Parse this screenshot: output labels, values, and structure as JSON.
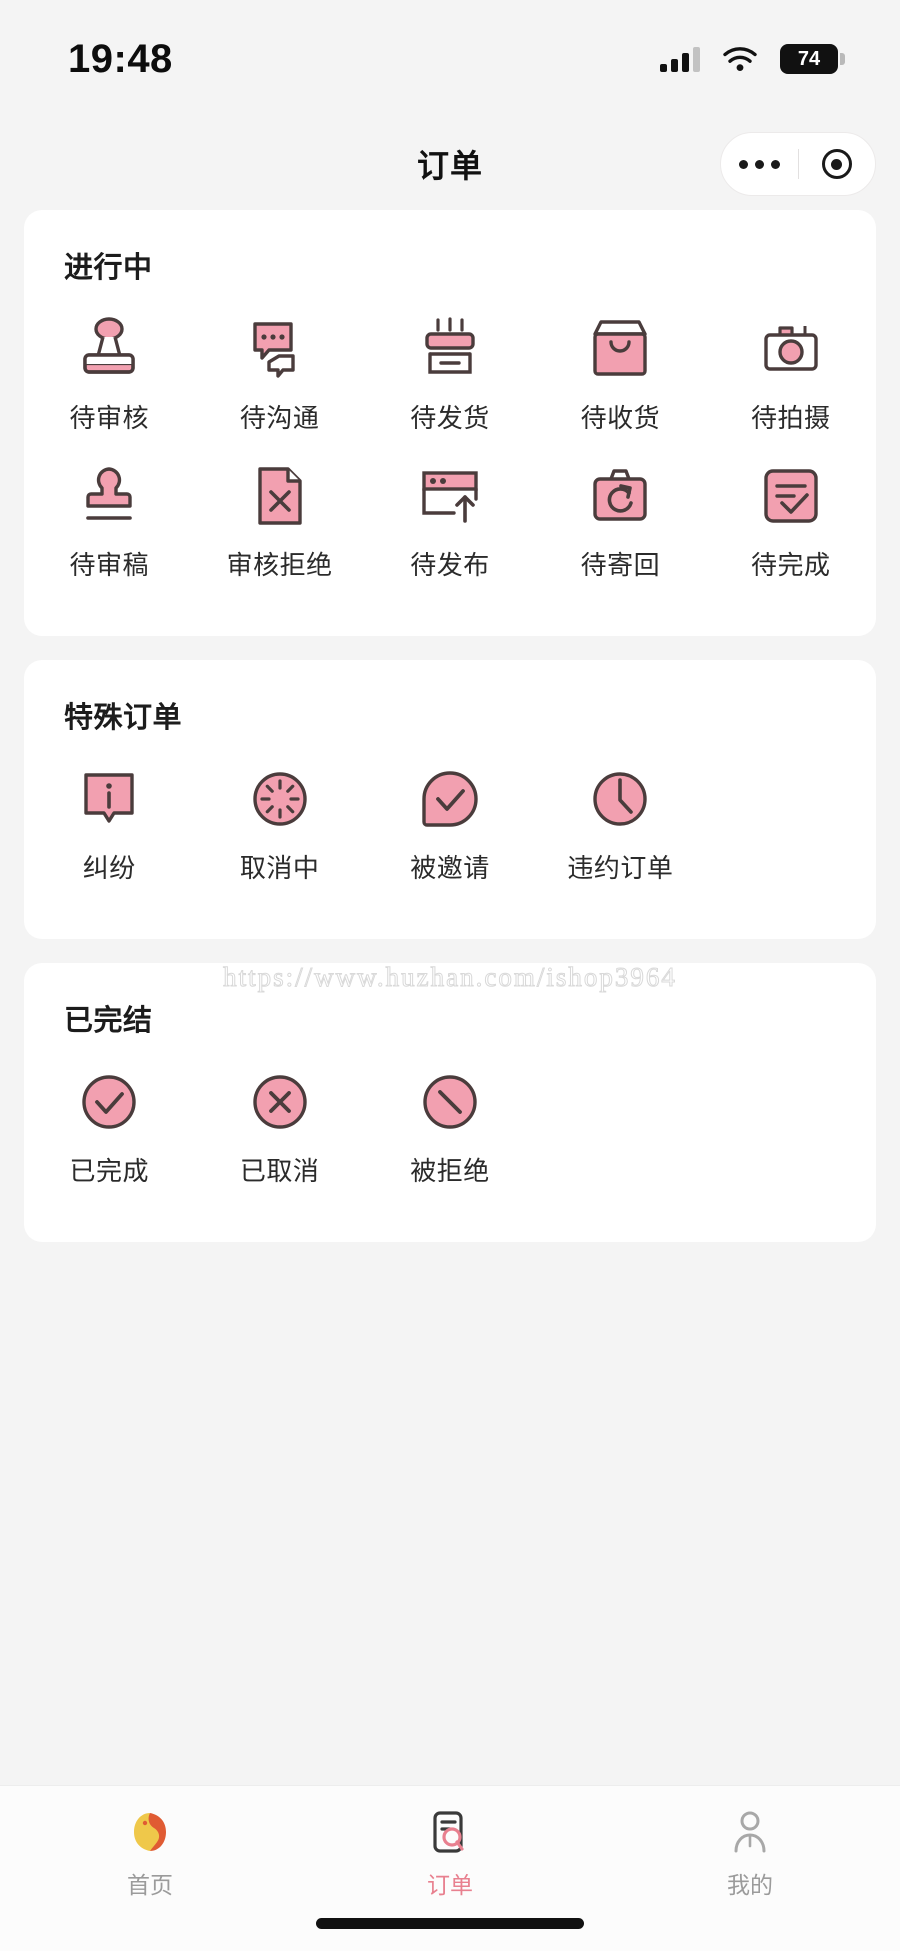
{
  "status_bar": {
    "time": "19:48",
    "battery_level": "74",
    "signal_icon": "cellular-signal-icon",
    "wifi_icon": "wifi-icon",
    "battery_icon": "battery-icon"
  },
  "header": {
    "title": "订单",
    "capsule": {
      "more_icon": "more-dots-icon",
      "target_icon": "target-circle-icon"
    }
  },
  "theme": {
    "accent": "#e8808f",
    "icon_fill": "#f2a0b0",
    "icon_stroke": "#4a3c3c",
    "page_bg": "#f4f4f4",
    "card_bg": "#ffffff"
  },
  "watermark": "https://www.huzhan.com/ishop3964",
  "sections": [
    {
      "title": "进行中",
      "items": [
        {
          "label": "待审核",
          "icon": "stamp-icon"
        },
        {
          "label": "待沟通",
          "icon": "chat-bubbles-icon"
        },
        {
          "label": "待发货",
          "icon": "package-ship-icon"
        },
        {
          "label": "待收货",
          "icon": "shopping-bag-icon"
        },
        {
          "label": "待拍摄",
          "icon": "camera-icon"
        },
        {
          "label": "待审稿",
          "icon": "stamp-press-icon"
        },
        {
          "label": "审核拒绝",
          "icon": "document-x-icon"
        },
        {
          "label": "待发布",
          "icon": "window-upload-icon"
        },
        {
          "label": "待寄回",
          "icon": "suitcase-return-icon"
        },
        {
          "label": "待完成",
          "icon": "checklist-icon"
        }
      ]
    },
    {
      "title": "特殊订单",
      "items": [
        {
          "label": "纠纷",
          "icon": "info-bubble-icon"
        },
        {
          "label": "取消中",
          "icon": "loading-spinner-icon"
        },
        {
          "label": "被邀请",
          "icon": "check-teardrop-icon"
        },
        {
          "label": "违约订单",
          "icon": "clock-icon"
        }
      ]
    },
    {
      "title": "已完结",
      "items": [
        {
          "label": "已完成",
          "icon": "check-circle-icon"
        },
        {
          "label": "已取消",
          "icon": "x-circle-icon"
        },
        {
          "label": "被拒绝",
          "icon": "slash-circle-icon"
        }
      ]
    }
  ],
  "tabbar": {
    "tabs": [
      {
        "label": "首页",
        "icon": "koi-fish-home-icon",
        "active": false
      },
      {
        "label": "订单",
        "icon": "order-search-icon",
        "active": true
      },
      {
        "label": "我的",
        "icon": "person-profile-icon",
        "active": false
      }
    ]
  }
}
